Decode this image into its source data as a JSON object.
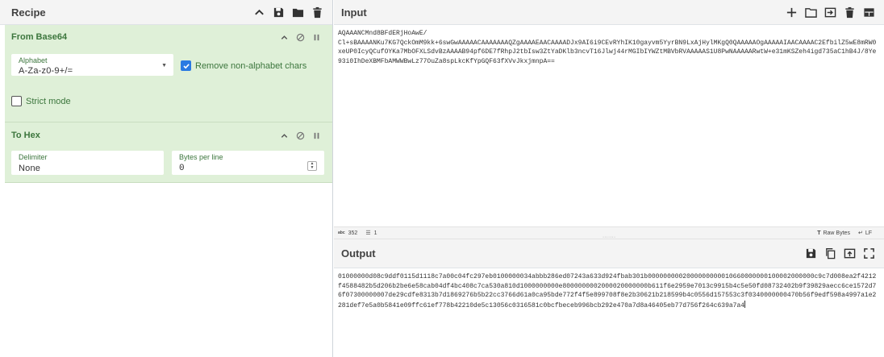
{
  "recipe": {
    "title": "Recipe",
    "operations": [
      {
        "name": "From Base64",
        "alphabet_label": "Alphabet",
        "alphabet_value": "A-Za-z0-9+/=",
        "remove_label": "Remove non-alphabet chars",
        "remove_checked": true,
        "strict_label": "Strict mode",
        "strict_checked": false
      },
      {
        "name": "To Hex",
        "delimiter_label": "Delimiter",
        "delimiter_value": "None",
        "bytes_label": "Bytes per line",
        "bytes_value": "0"
      }
    ]
  },
  "input": {
    "title": "Input",
    "text": "AQAAANCMnd8BFdERjHoAwE/\nCl+sBAAAANKu7KG7QckOmM9kk+6swGwAAAAACAAAAAAAQZgAAAAEAACAAAADJx9AI6i9CEvRYhIK10gayvm5YyrBN9LxAjHylMKgQ0QAAAAAOgAAAAAIAACAAAAC2EfbilZ5wE8mRW0xeUP0IcyQCufOYKa7MbOFXLSdvBzAAAAB94pf6DE7fRhpJ2tbIsw3ZtYaDKlb3ncvT16Jlwj44rMGIbIYWZtMBVbRVAAAAAS1U8PwNAAAAARwtW+e31mKSZeh4igd735aC1hB4J/8Ye93i0IhDeXBMFbAMWWBwLz77OuZa8spLkcKfYpGQF63fXVvJkxjmnpA==",
    "status_length_icon": "abc",
    "status_length": "352",
    "status_lines": "1",
    "raw_bytes": "Raw Bytes",
    "eol": "LF"
  },
  "output": {
    "title": "Output",
    "text": "01000000d08c9ddf0115d1118c7a00c04fc297eb0100000034abbb286ed07243a633d924fbab301b0000000002000000000010660000000100002000000c9c7d008ea2f4212f4588482b5d206b2be6e58cab04df4bc408c7ca530a810d1000000000e8000000002000020000000b611f6e2959e7013c9915b4c5e50fd08732402b9f39829aecc6ce1572d76f07300000007de29cdfe8313b7d1869276b5b22cc3766d61a0ca95bde772f4f5e899708f8e2b30621b218599b4c0556d157553c3f0340000000470b56f9edf598a4997a1e2281def7e5a0b5841e09ffc61ef778b42210de5c13056c0316581c0bcfbeceb996bcb292e470a7d8a46405eb77d756f264c639a7a4"
  }
}
